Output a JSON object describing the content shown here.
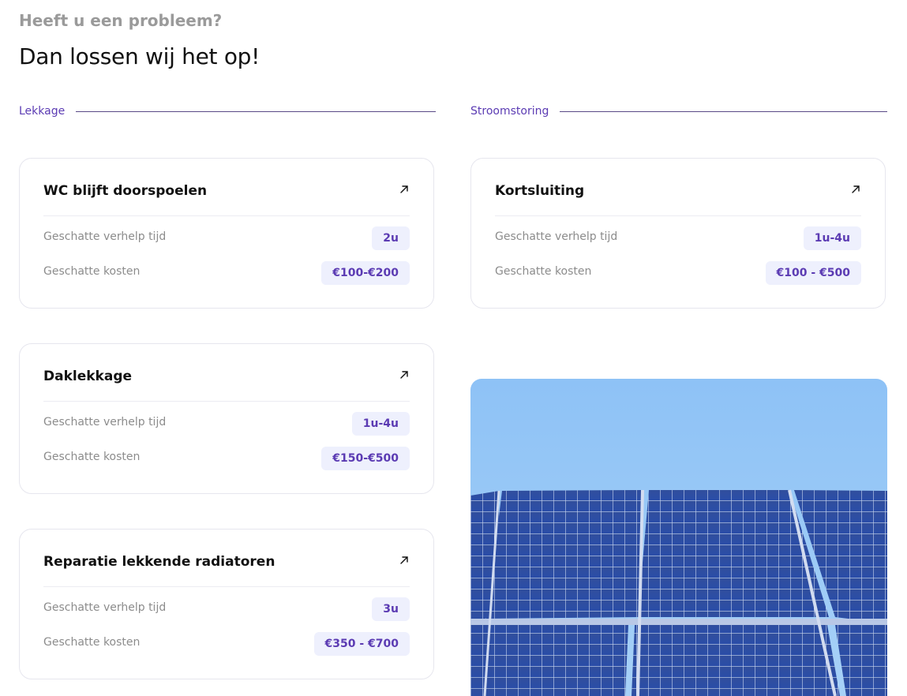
{
  "header": {
    "eyebrow": "Heeft u een probleem?",
    "headline": "Dan lossen wij het op!"
  },
  "categories": {
    "left": "Lekkage",
    "right": "Stroomstoring"
  },
  "cards": {
    "wc": {
      "title": "WC blijft doorspoelen",
      "time_label": "Geschatte verhelp tijd",
      "time_value": "2u",
      "cost_label": "Geschatte kosten",
      "cost_value": "€100-€200"
    },
    "kort": {
      "title": "Kortsluiting",
      "time_label": "Geschatte verhelp tijd",
      "time_value": "1u-4u",
      "cost_label": "Geschatte kosten",
      "cost_value": "€100 - €500"
    },
    "dak": {
      "title": "Daklekkage",
      "time_label": "Geschatte verhelp tijd",
      "time_value": "1u-4u",
      "cost_label": "Geschatte kosten",
      "cost_value": "€150-€500"
    },
    "rad": {
      "title": "Reparatie lekkende radiatoren",
      "time_label": "Geschatte verhelp tijd",
      "time_value": "3u",
      "cost_label": "Geschatte kosten",
      "cost_value": "€350 - €700"
    }
  },
  "icons": {
    "card_arrow": "arrow-up-right-icon"
  },
  "colors": {
    "accent": "#5b3bb3",
    "pill_bg": "#eef0fd",
    "sky": "#8fc3f5",
    "panel": "#2e4fa8"
  }
}
